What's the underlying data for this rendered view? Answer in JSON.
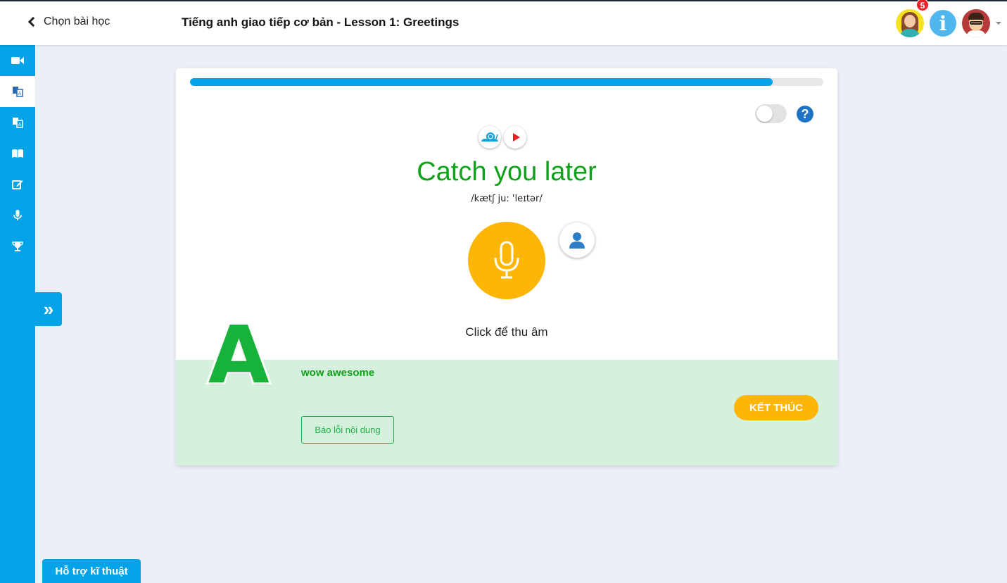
{
  "header": {
    "back_label": "Chọn bài học",
    "lesson_title": "Tiếng anh giao tiếp cơ bản - Lesson 1: Greetings",
    "notification_count": "5",
    "info_label": "i"
  },
  "sidebar": {
    "items": [
      {
        "icon": "video-camera-icon"
      },
      {
        "icon": "translate-icon"
      },
      {
        "icon": "translate-icon"
      },
      {
        "icon": "open-book-icon"
      },
      {
        "icon": "edit-icon"
      },
      {
        "icon": "microphone-icon"
      },
      {
        "icon": "trophy-icon"
      }
    ],
    "expand_label": "»",
    "support_label": "Hỗ trợ kĩ thuật"
  },
  "lesson": {
    "progress": 0.92,
    "help_label": "?",
    "phrase": "Catch you later",
    "ipa": "/kætʃ ju: 'leɪtər/",
    "record_hint": "Click để thu âm",
    "grade": "A",
    "feedback": "wow awesome",
    "report_label": "Báo lỗi nội dung",
    "finish_label": "KẾT THÚC"
  },
  "colors": {
    "accent": "#03a4e7",
    "phrase_green": "#0fa21a",
    "mic_yellow": "#fdb606",
    "result_bg": "#d5f0dd"
  }
}
